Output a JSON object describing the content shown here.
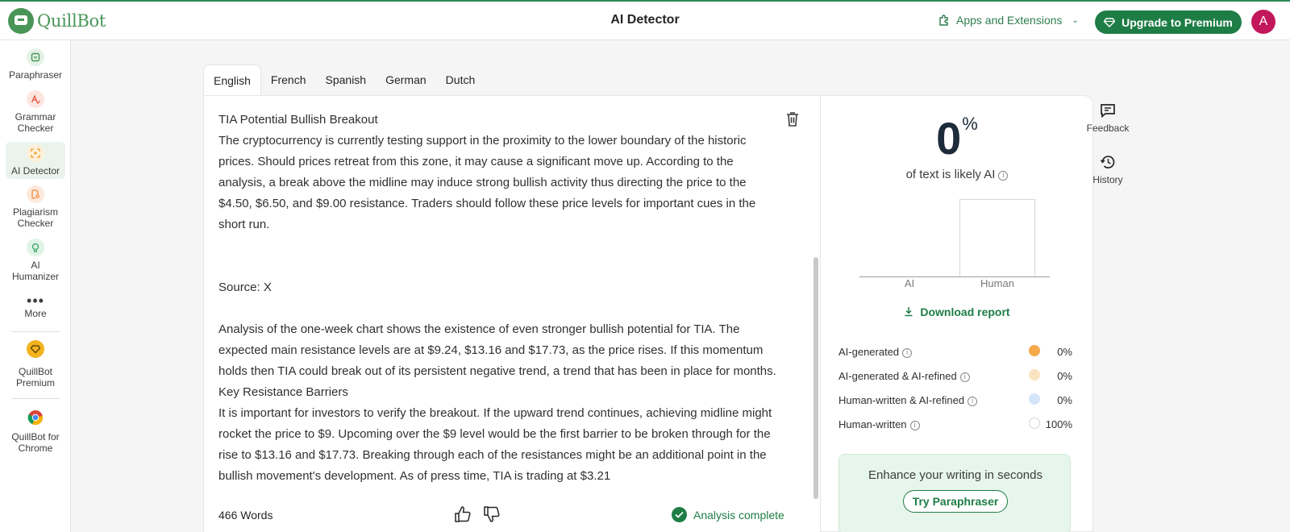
{
  "app": {
    "logo_text": "QuillBot",
    "page_title": "AI Detector",
    "apps_label": "Apps and Extensions",
    "upgrade_label": "Upgrade to Premium",
    "avatar_initial": "A"
  },
  "sidebar": {
    "items": [
      {
        "label": "Paraphraser",
        "icon": "paraphraser-icon",
        "color": "#499557"
      },
      {
        "label": "Grammar Checker",
        "icon": "grammar-checker-icon",
        "color": "#e8533f"
      },
      {
        "label": "AI Detector",
        "icon": "ai-detector-icon",
        "color": "#f0a030"
      },
      {
        "label": "Plagiarism Checker",
        "icon": "plagiarism-checker-icon",
        "color": "#f08a3c"
      },
      {
        "label": "AI Humanizer",
        "icon": "ai-humanizer-icon",
        "color": "#36a55f"
      },
      {
        "label": "More",
        "icon": "more-icon",
        "color": "#3d3d3d"
      },
      {
        "label": "QuillBot Premium",
        "icon": "premium-diamond-icon",
        "color": "#f2b320"
      },
      {
        "label": "QuillBot for Chrome",
        "icon": "chrome-icon",
        "color": "#4285f4"
      }
    ]
  },
  "tabs": [
    "English",
    "French",
    "Spanish",
    "German",
    "Dutch"
  ],
  "active_tab": "English",
  "editor": {
    "paragraphs": [
      "TIA Potential Bullish Breakout",
      "The cryptocurrency is currently testing support in the proximity to the lower boundary of the historic prices. Should prices retreat from this zone, it may cause a significant move up. According to the analysis, a break above the midline may induce strong bullish activity thus directing the price to the $4.50, $6.50, and $9.00 resistance. Traders should follow these price levels for important cues in the short run.",
      "",
      "",
      "Source: X",
      "",
      "Analysis of the one-week chart shows the existence of even stronger bullish potential for TIA. The expected main resistance levels are at $9.24, $13.16 and $17.73, as the price rises. If this momentum holds then TIA could break out of its persistent negative trend, a trend that has been in place for months.",
      "Key Resistance Barriers",
      "It is important for investors to verify the breakout. If the upward trend continues, achieving midline might rocket the price to $9. Upcoming over the $9 level would be the first barrier to be broken through for the rise to $13.16 and $17.73. Breaking through each of the resistances might be an additional point in the bullish movement's development. As of press time, TIA is trading at $3.21"
    ],
    "word_count": "466 Words",
    "analysis_status": "Analysis complete"
  },
  "results": {
    "score": "0",
    "score_unit": "%",
    "score_caption": "of text is likely AI",
    "chart": {
      "categories": [
        "AI",
        "Human"
      ],
      "values": [
        0,
        100
      ]
    },
    "download_label": "Download report",
    "breakdown": [
      {
        "label": "AI-generated",
        "value": "0%",
        "color": "#f5a94a"
      },
      {
        "label": "AI-generated & AI-refined",
        "value": "0%",
        "color": "#fbe3c2"
      },
      {
        "label": "Human-written & AI-refined",
        "value": "0%",
        "color": "#d4e4fb"
      },
      {
        "label": "Human-written",
        "value": "100%",
        "color": "#ffffff"
      }
    ],
    "promo_text": "Enhance your writing in seconds",
    "promo_button": "Try Paraphraser"
  },
  "rail": {
    "feedback_label": "Feedback",
    "history_label": "History"
  }
}
